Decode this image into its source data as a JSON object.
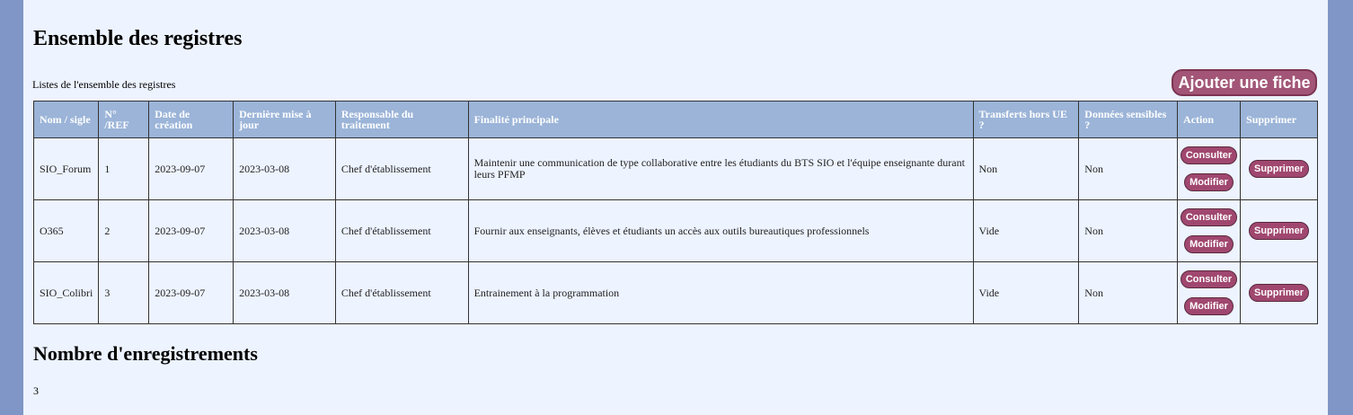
{
  "page": {
    "title": "Ensemble des registres",
    "subtitle": "Listes de l'ensemble des registres",
    "add_button": "Ajouter une fiche",
    "count_title": "Nombre d'enregistrements",
    "count_value": "3"
  },
  "table": {
    "headers": [
      "Nom / sigle",
      "N° /REF",
      "Date de création",
      "Dernière mise à jour",
      "Responsable du traitement",
      "Finalité principale",
      "Transferts hors UE ?",
      "Données sensibles ?",
      "Action",
      "Supprimer"
    ],
    "rows": [
      {
        "nom": "SIO_Forum",
        "ref": "1",
        "creation": "2023-09-07",
        "maj": "2023-03-08",
        "responsable": "Chef d'établissement",
        "finalite": "Maintenir une communication de type collaborative entre les étudiants du BTS SIO et l'équipe enseignante durant leurs PFMP",
        "transferts": "Non",
        "sensibles": "Non",
        "consulter": "Consulter",
        "modifier": "Modifier",
        "supprimer": "Supprimer"
      },
      {
        "nom": "O365",
        "ref": "2",
        "creation": "2023-09-07",
        "maj": "2023-03-08",
        "responsable": "Chef d'établissement",
        "finalite": "Fournir aux enseignants, élèves et étudiants un accès aux outils bureautiques professionnels",
        "transferts": "Vide",
        "sensibles": "Non",
        "consulter": "Consulter",
        "modifier": "Modifier",
        "supprimer": "Supprimer"
      },
      {
        "nom": "SIO_Colibri",
        "ref": "3",
        "creation": "2023-09-07",
        "maj": "2023-03-08",
        "responsable": "Chef d'établissement",
        "finalite": "Entrainement à la programmation",
        "transferts": "Vide",
        "sensibles": "Non",
        "consulter": "Consulter",
        "modifier": "Modifier",
        "supprimer": "Supprimer"
      }
    ]
  },
  "colors": {
    "background_frame": "#7f96c6",
    "page": "#edf3ff",
    "header": "#9bb4d8",
    "button": "#a0476f"
  }
}
